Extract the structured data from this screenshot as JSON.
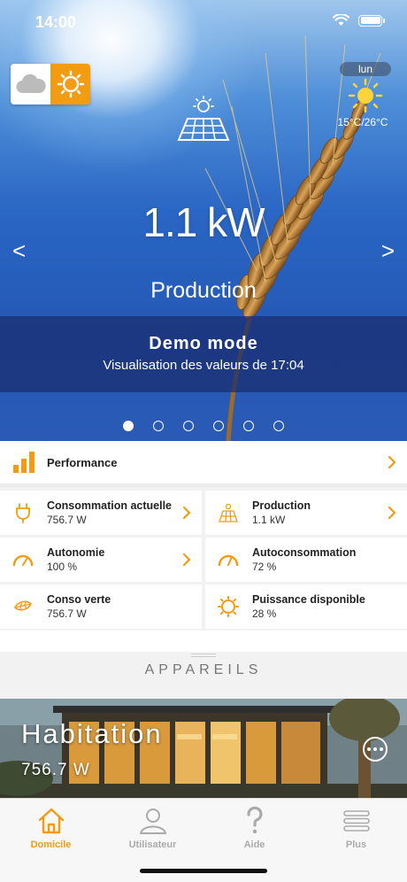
{
  "status_bar": {
    "time": "14:00"
  },
  "hero": {
    "weather_day": "lun",
    "weather_temp": "15°C/26°C",
    "power_value": "1.1 kW",
    "power_label": "Production",
    "prev_arrow": "<",
    "next_arrow": ">",
    "demo_title": "Demo mode",
    "demo_subtitle": "Visualisation des valeurs de 17:04",
    "page_count": 6,
    "active_page": 1
  },
  "performance": {
    "label": "Performance"
  },
  "tiles": [
    {
      "title": "Consommation actuelle",
      "value": "756.7 W",
      "icon": "plug-icon",
      "chevron": true
    },
    {
      "title": "Production",
      "value": "1.1 kW",
      "icon": "solar-panel-icon",
      "chevron": true
    },
    {
      "title": "Autonomie",
      "value": "100 %",
      "icon": "gauge-icon",
      "chevron": true
    },
    {
      "title": "Autoconsommation",
      "value": "72 %",
      "icon": "gauge-icon",
      "chevron": false
    },
    {
      "title": "Conso verte",
      "value": "756.7 W",
      "icon": "leaf-icon",
      "chevron": false
    },
    {
      "title": "Puissance disponible",
      "value": "28 %",
      "icon": "sun-icon",
      "chevron": false
    }
  ],
  "section": {
    "title": "APPAREILS"
  },
  "house": {
    "title": "Habitation",
    "value": "756.7 W"
  },
  "tabs": [
    {
      "label": "Domicile",
      "icon": "home-icon",
      "active": true
    },
    {
      "label": "Utilisateur",
      "icon": "user-icon",
      "active": false
    },
    {
      "label": "Aide",
      "icon": "help-icon",
      "active": false
    },
    {
      "label": "Plus",
      "icon": "menu-icon",
      "active": false
    }
  ],
  "colors": {
    "accent": "#f39c12",
    "sky_blue": "#2a66c4",
    "demo_band": "#192d6e"
  }
}
